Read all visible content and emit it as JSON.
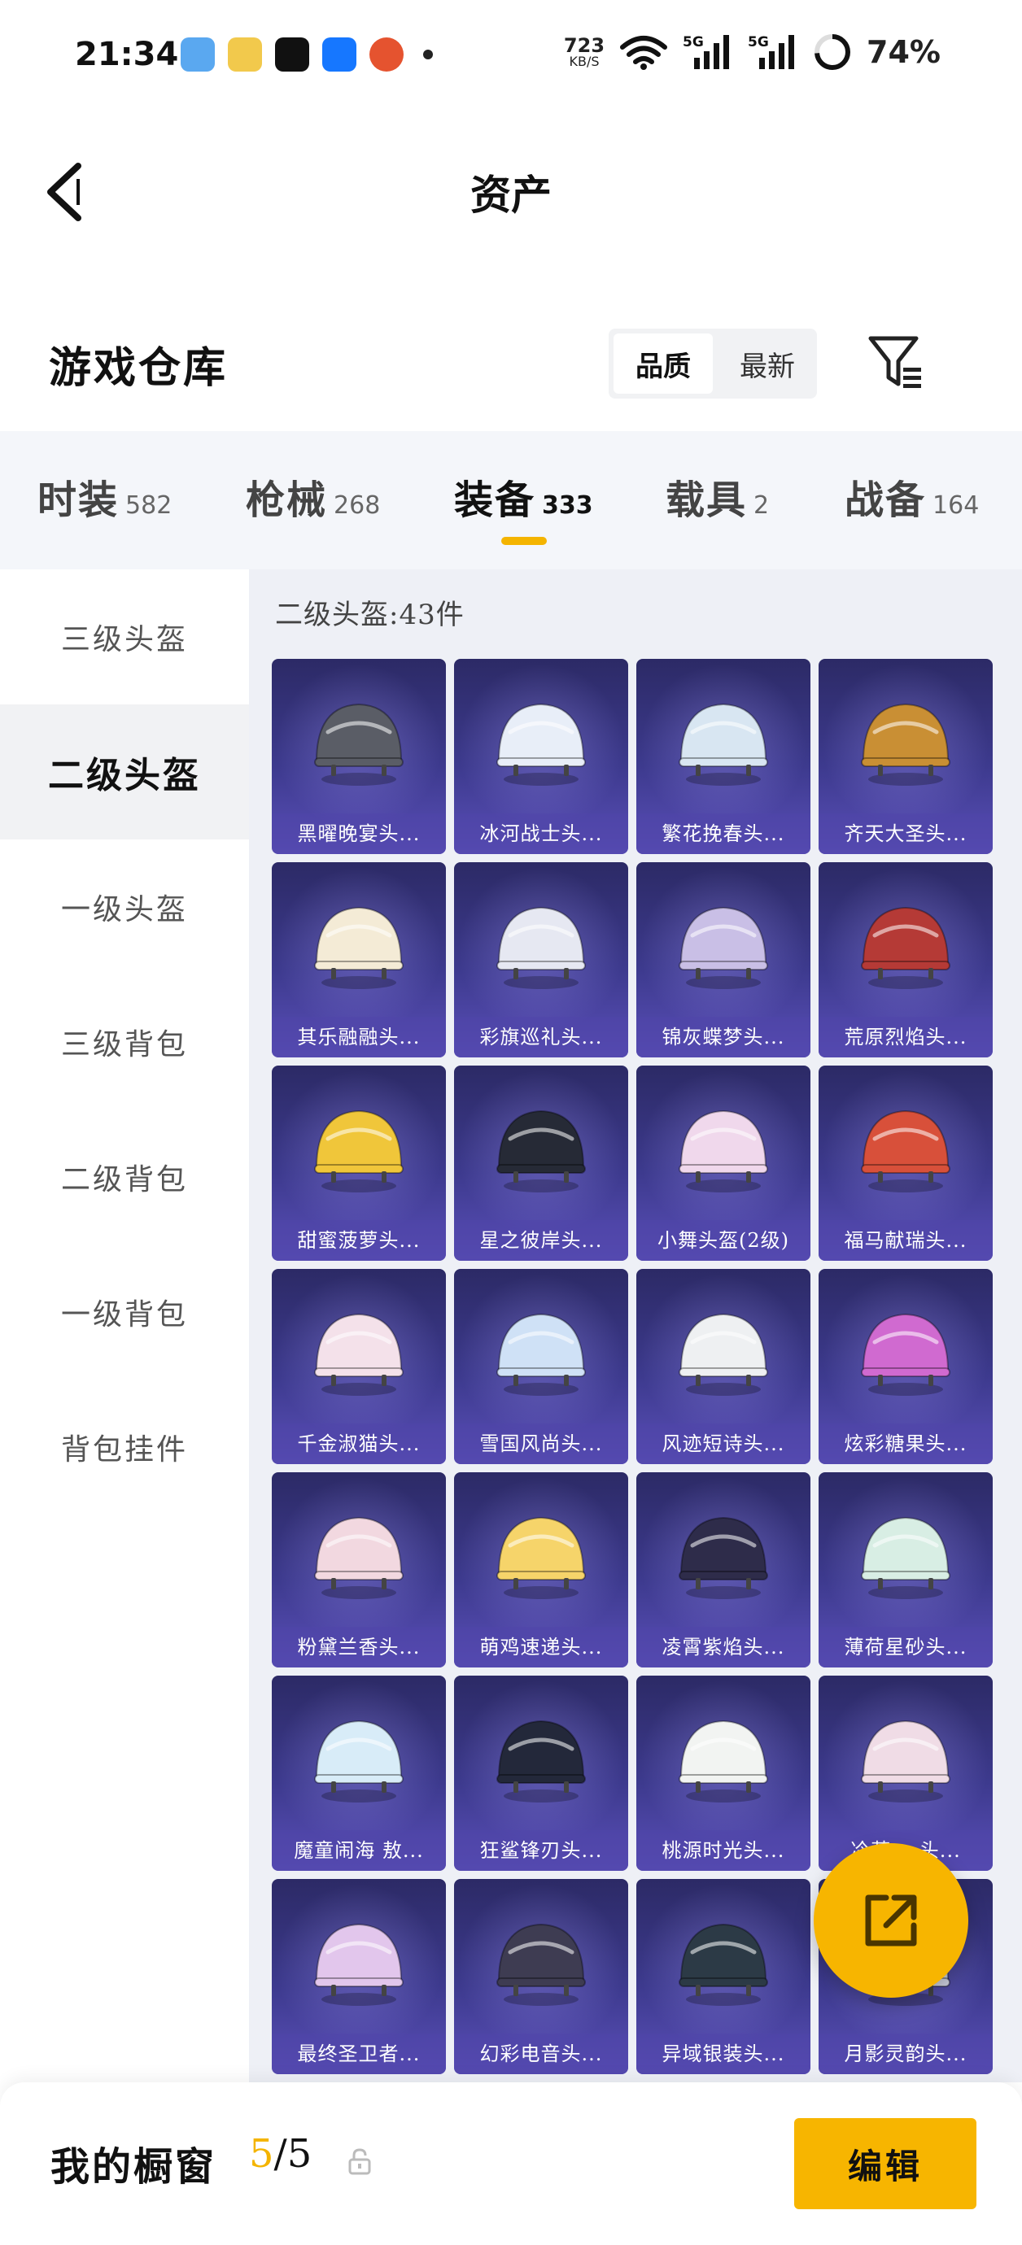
{
  "status_bar": {
    "time": "21:34",
    "net_speed_value": "723",
    "net_speed_unit": "KB/S",
    "signal_1": "5G",
    "signal_2": "5G",
    "battery": "74%"
  },
  "header": {
    "title": "资产"
  },
  "warehouse": {
    "title": "游戏仓库",
    "sort_options": [
      "品质",
      "最新"
    ],
    "active_sort": "品质"
  },
  "tabs": [
    {
      "label": "时装",
      "count": "582"
    },
    {
      "label": "枪械",
      "count": "268"
    },
    {
      "label": "装备",
      "count": "333"
    },
    {
      "label": "载具",
      "count": "2"
    },
    {
      "label": "战备",
      "count": "164"
    }
  ],
  "active_tab": "装备",
  "sidebar": {
    "items": [
      "三级头盔",
      "二级头盔",
      "一级头盔",
      "三级背包",
      "二级背包",
      "一级背包",
      "背包挂件"
    ],
    "active": "二级头盔"
  },
  "content": {
    "heading": "二级头盔:43件",
    "items": [
      "黑曜晚宴头...",
      "冰河战士头...",
      "繁花挽春头...",
      "齐天大圣头...",
      "其乐融融头...",
      "彩旗巡礼头...",
      "锦灰蝶梦头...",
      "荒原烈焰头...",
      "甜蜜菠萝头...",
      "星之彼岸头...",
      "小舞头盔(2级)",
      "福马献瑞头...",
      "千金淑猫头...",
      "雪国风尚头...",
      "风迹短诗头...",
      "炫彩糖果头...",
      "粉黛兰香头...",
      "萌鸡速递头...",
      "凌霄紫焰头...",
      "薄荷星砂头...",
      "魔童闹海 敖...",
      "狂鲨锋刃头...",
      "桃源时光头...",
      "冷萌... 头...",
      "最终圣卫者...",
      "幻彩电音头...",
      "异域银装头...",
      "月影灵韵头..."
    ],
    "colors": [
      "#5a5d66",
      "#e8eef8",
      "#d8e6f2",
      "#c98f34",
      "#f4ebd6",
      "#e6e8f2",
      "#c9bfe6",
      "#b53a36",
      "#f0c63a",
      "#262a36",
      "#f0d8ec",
      "#d8503a",
      "#f4e1ea",
      "#cfe1f6",
      "#eef0f2",
      "#d06ad0",
      "#f2d8e0",
      "#f6d46a",
      "#2e2c4a",
      "#d8eee4",
      "#d8ecf8",
      "#23283a",
      "#f2f4f2",
      "#f0dce6",
      "#e2c6ec",
      "#3e3c52",
      "#2c3a46",
      "#cfd2e0"
    ]
  },
  "bottom_bar": {
    "label": "我的橱窗",
    "current": "5",
    "separator_total": "/5",
    "edit_label": "编辑"
  },
  "accent_color": "#f7b500"
}
